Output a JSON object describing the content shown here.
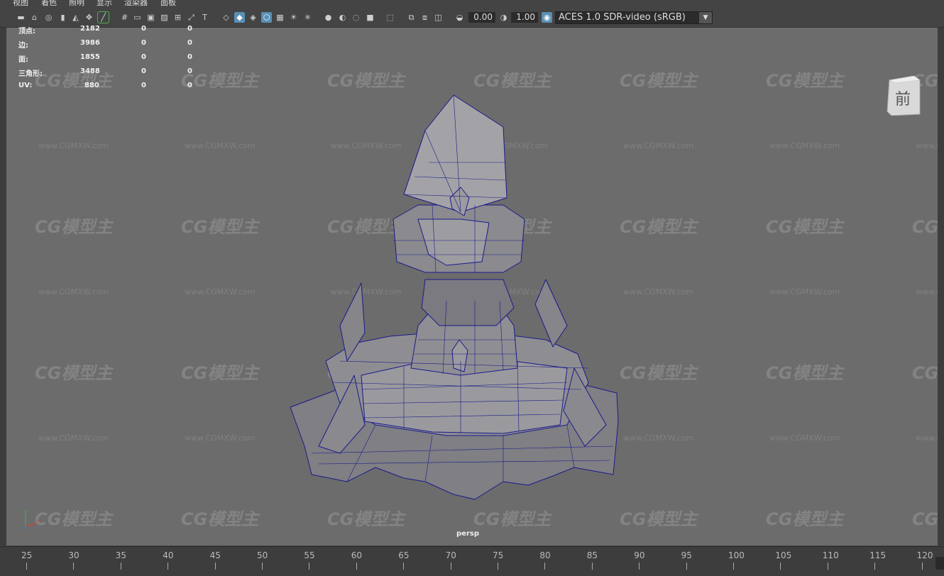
{
  "menu": [
    "视图",
    "着色",
    "照明",
    "显示",
    "渲染器",
    "面板"
  ],
  "toolbar": {
    "icons": [
      "camera-icon",
      "camera-lock-icon",
      "camera-attr-icon",
      "bookmark-icon",
      "image-plane-icon",
      "2d-pan-icon",
      "grease-pencil-icon",
      "grid-icon",
      "film-gate-icon",
      "resolution-gate-icon",
      "gate-mask-icon",
      "field-chart-icon",
      "safe-action-icon",
      "safe-title-icon",
      "wireframe-icon",
      "smooth-shade-icon",
      "default-material-icon",
      "wireframe-on-shaded-icon",
      "xray-icon",
      "textured-icon",
      "use-lights-icon",
      "shadows-icon",
      "ambient-occlusion-icon",
      "motion-blur-icon",
      "multisample-icon",
      "depth-of-field-icon",
      "isolate-select-icon",
      "xray-joints-icon",
      "xray-active-icon",
      "backface-icon",
      "exposure-icon",
      "gamma-icon",
      "color-mgmt-icon"
    ],
    "exposure": "0.00",
    "gamma": "1.00",
    "color_space": "ACES 1.0 SDR-video (sRGB)"
  },
  "stats": [
    {
      "label": "顶点:",
      "v1": "2182",
      "v2": "0",
      "v3": "0"
    },
    {
      "label": "边:",
      "v1": "3986",
      "v2": "0",
      "v3": "0"
    },
    {
      "label": "面:",
      "v1": "1855",
      "v2": "0",
      "v3": "0"
    },
    {
      "label": "三角形:",
      "v1": "3488",
      "v2": "0",
      "v3": "0"
    },
    {
      "label": "UV:",
      "v1": "880",
      "v2": "0",
      "v3": "0"
    }
  ],
  "viewcube_label": "前",
  "camera_label": "persp",
  "axis": {
    "y": "y",
    "x": "x"
  },
  "watermark_logo": "CG模型主",
  "watermark_url": "www.CGMXW.com",
  "timeline_ticks": [
    "25",
    "30",
    "35",
    "40",
    "45",
    "50",
    "55",
    "60",
    "65",
    "70",
    "75",
    "80",
    "85",
    "90",
    "95",
    "100",
    "105",
    "110",
    "115",
    "120"
  ],
  "colors": {
    "viewport_bg": "#6c6c6c",
    "wire": "#1a1a8c",
    "mesh": "#8a8a8e",
    "selected_tool": "#5a8fb5"
  }
}
